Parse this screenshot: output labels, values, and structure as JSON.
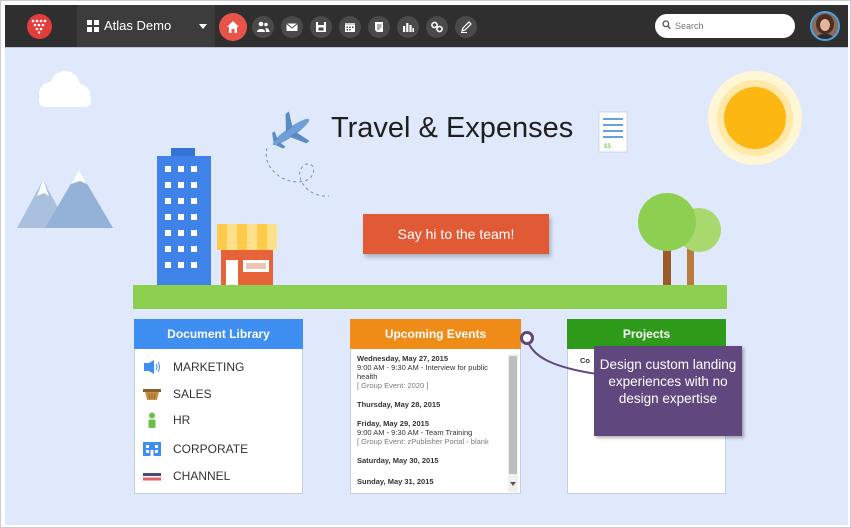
{
  "topbar": {
    "site_name": "Atlas Demo",
    "search_placeholder": "Search",
    "nav_icons": [
      "home-icon",
      "people-icon",
      "mail-icon",
      "save-icon",
      "calendar-icon",
      "document-icon",
      "chart-icon",
      "link-icon",
      "pen-icon"
    ]
  },
  "hero": {
    "title": "Travel & Expenses",
    "cta_label": "Say hi to the team!"
  },
  "document_library": {
    "title": "Document Library",
    "items": [
      {
        "label": "MARKETING",
        "icon": "megaphone-icon",
        "color": "#3f8ef2"
      },
      {
        "label": "SALES",
        "icon": "basket-icon",
        "color": "#b8863b"
      },
      {
        "label": "HR",
        "icon": "person-icon",
        "color": "#6cc04a"
      },
      {
        "label": "CORPORATE",
        "icon": "building-icon",
        "color": "#3f8ef2"
      },
      {
        "label": "CHANNEL",
        "icon": "flag-icon",
        "color": "#4a4a7a"
      }
    ]
  },
  "upcoming_events": {
    "title": "Upcoming Events",
    "days": [
      {
        "date": "Wednesday, May 27, 2015",
        "lines": [
          "9:00 AM - 9:30 AM - Interview for public",
          "health"
        ],
        "meta": "[ Group Event: 2020 ]"
      },
      {
        "date": "Thursday, May 28, 2015",
        "lines": [],
        "meta": ""
      },
      {
        "date": "Friday, May 29, 2015",
        "lines": [
          "9:00 AM - 9:30 AM - Team Training"
        ],
        "meta": "[ Group Event: zPublisher Portal - blank"
      },
      {
        "date": "Saturday, May 30, 2015",
        "lines": [],
        "meta": ""
      },
      {
        "date": "Sunday, May 31, 2015",
        "lines": [],
        "meta": ""
      }
    ]
  },
  "projects": {
    "title": "Projects",
    "partial_text": "Co"
  },
  "callout": {
    "text": "Design custom landing experiences with no design expertise"
  },
  "colors": {
    "topbar": "#2f2f2f",
    "canvas": "#dfe9fb",
    "accent_home": "#e8534a",
    "cta": "#e05a35",
    "doc_library": "#3f8ef2",
    "events": "#ef8b17",
    "projects": "#2f9b1b",
    "callout": "#60477e",
    "ground": "#8dcf50"
  }
}
